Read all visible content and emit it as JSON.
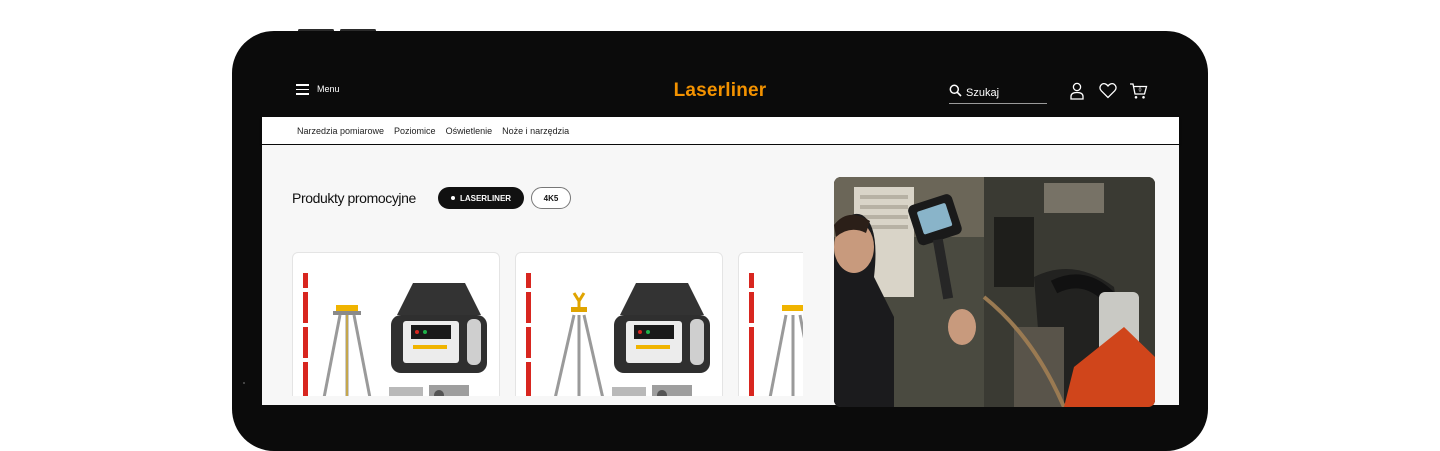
{
  "header": {
    "menu_label": "Menu",
    "logo": "Laserliner",
    "search_placeholder": "Szukaj"
  },
  "nav": {
    "items": [
      "Narzedzia pomiarowe",
      "Poziomice",
      "Oświetlenie",
      "Noże i narzędzia"
    ]
  },
  "promo": {
    "title": "Produkty promocyjne",
    "filters": [
      {
        "label": "LASERLINER",
        "active": true
      },
      {
        "label": "4K5",
        "active": false
      }
    ]
  },
  "colors": {
    "brand": "#f39200",
    "frame": "#0b0b0b",
    "content_bg": "#f7f7f7"
  },
  "icons": [
    "menu-icon",
    "search-icon",
    "user-icon",
    "heart-icon",
    "cart-icon"
  ]
}
